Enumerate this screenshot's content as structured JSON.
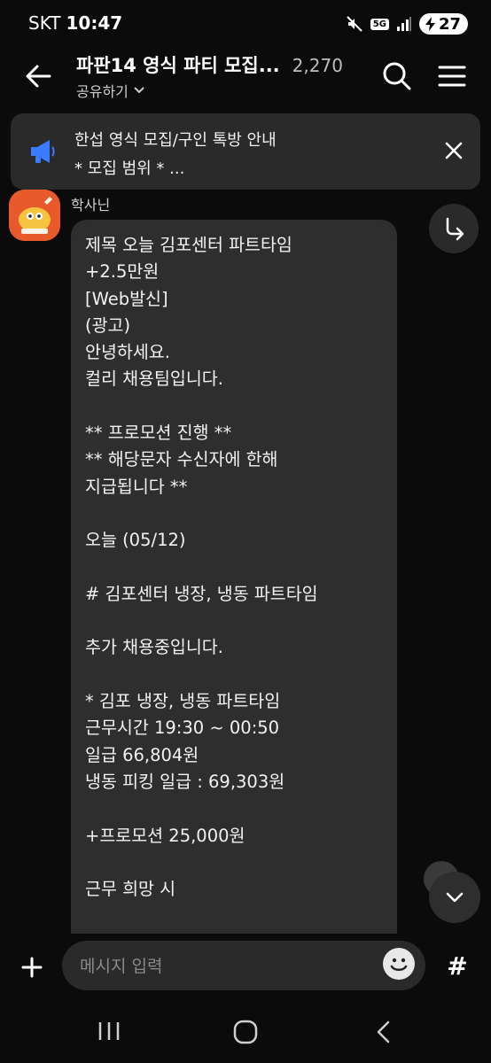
{
  "status_bar": {
    "carrier": "SKT",
    "time": "10:47",
    "network": "5G",
    "battery": "27"
  },
  "header": {
    "title": "파판14 영식 파티 모집...",
    "member_count": "2,270",
    "share_label": "공유하기",
    "icons": [
      "back-arrow-icon",
      "search-icon",
      "menu-icon"
    ]
  },
  "notice": {
    "title": "한섭 영식 모집/구인 톡방 안내",
    "preview": " * 모집 범위 *  ...",
    "icon": "megaphone-icon",
    "accent": "#3b7bff"
  },
  "message": {
    "sender": "학사닌",
    "text": "제목 오늘 김포센터 파트타임\n+2.5만원\n[Web발신]\n(광고)\n안녕하세요.\n컬리 채용팀입니다.\n\n** 프로모션 진행 **\n** 해당문자 수신자에 한해\n지급됩니다 **\n\n오늘 (05/12)\n\n# 김포센터 냉장, 냉동 파트타임\n\n추가 채용중입니다.\n\n* 김포 냉장, 냉동 파트타임\n근무시간 19:30 ~ 00:50\n일급 66,804원\n냉동 피킹 일급 : 69,303원\n\n+프로모션 25,000원\n\n근무 희망 시"
  },
  "input": {
    "placeholder": "메시지 입력",
    "value": ""
  },
  "hash_label": "#",
  "colors": {
    "background": "#0b0b0b",
    "bubble": "#2e2e2e",
    "notice_bg": "#2a2a2a"
  }
}
